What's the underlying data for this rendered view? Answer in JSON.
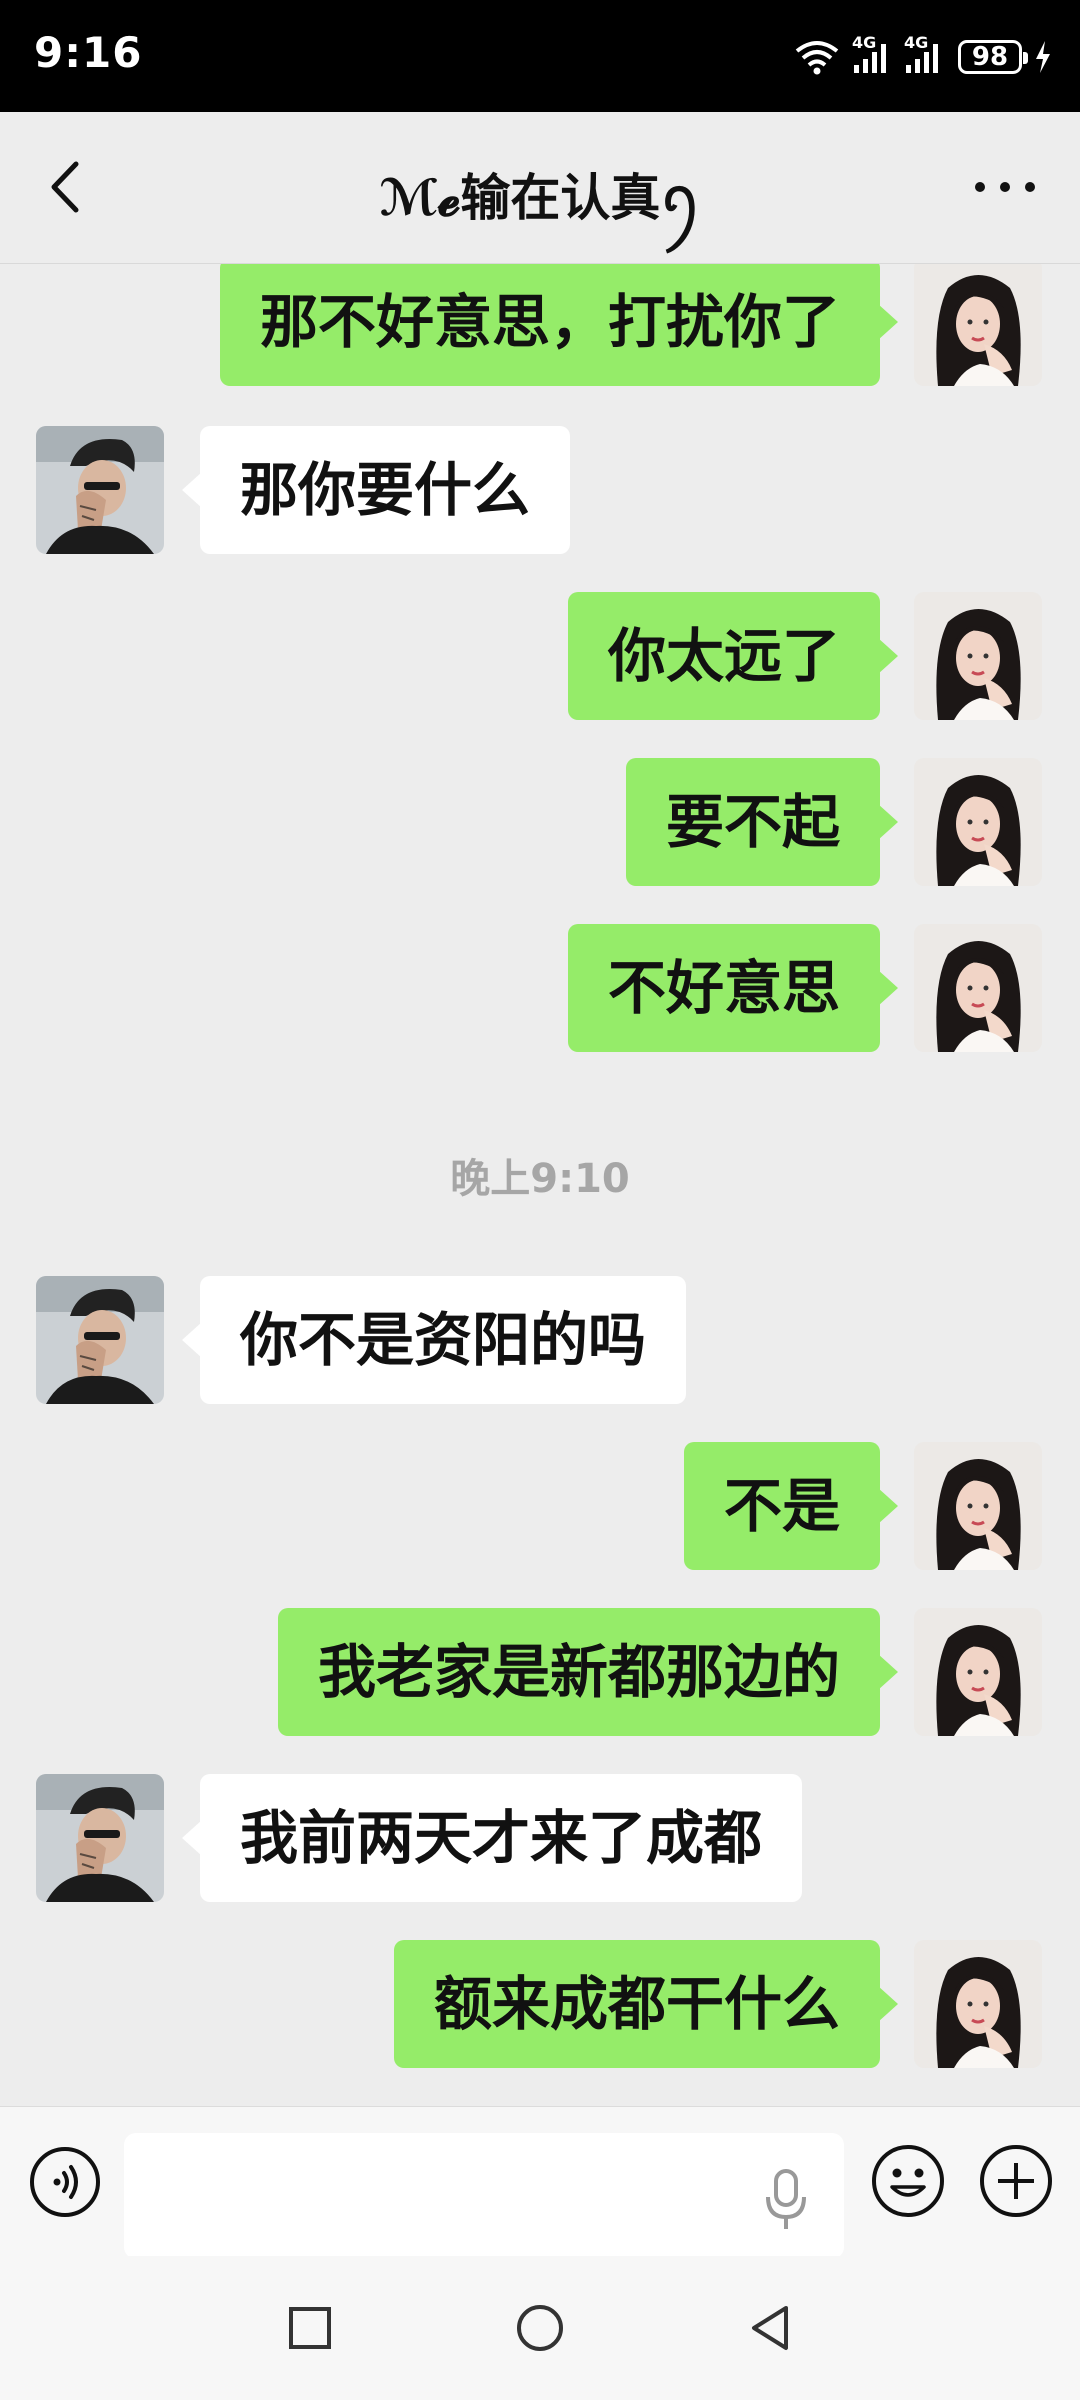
{
  "status_bar": {
    "time": "9:16",
    "network_1": "4G",
    "network_2": "4G",
    "battery": "98"
  },
  "header": {
    "title": "ℳ𝓮输在认真ꪆ",
    "back_icon": "chevron-left-icon",
    "more_icon": "more-dots-icon"
  },
  "messages": [
    {
      "side": "out",
      "text": "那不好意思，打扰你了"
    },
    {
      "side": "in",
      "text": "那你要什么"
    },
    {
      "side": "out",
      "text": "你太远了"
    },
    {
      "side": "out",
      "text": "要不起"
    },
    {
      "side": "out",
      "text": "不好意思"
    },
    {
      "side": "in",
      "text": "你不是资阳的吗"
    },
    {
      "side": "out",
      "text": "不是"
    },
    {
      "side": "out",
      "text": "我老家是新都那边的"
    },
    {
      "side": "in",
      "text": "我前两天才来了成都"
    },
    {
      "side": "out",
      "text": "额来成都干什么"
    }
  ],
  "timestamp": "晚上9:10",
  "input_bar": {
    "value": "",
    "voice_icon": "voice-icon",
    "mic_icon": "mic-icon",
    "emoji_icon": "emoji-icon",
    "plus_icon": "plus-icon"
  },
  "colors": {
    "outgoing_bubble": "#95ec69",
    "incoming_bubble": "#ffffff",
    "background": "#ededed"
  }
}
